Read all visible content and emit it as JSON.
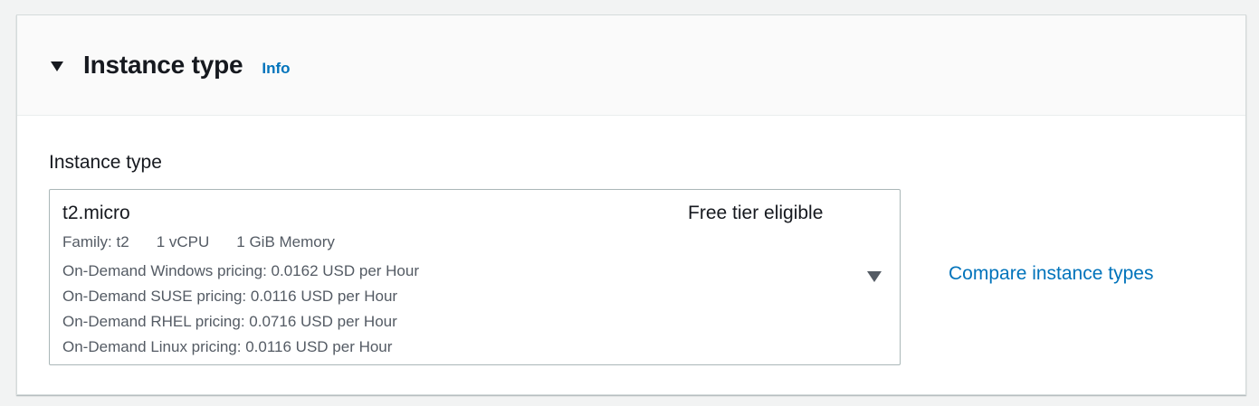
{
  "section": {
    "title": "Instance type",
    "info_label": "Info"
  },
  "field": {
    "label": "Instance type"
  },
  "select": {
    "value": "t2.micro",
    "badge": "Free tier eligible",
    "tags": [
      "Family: t2",
      "1 vCPU",
      "1 GiB Memory"
    ],
    "pricing": [
      "On-Demand Windows pricing: 0.0162 USD per Hour",
      "On-Demand SUSE pricing: 0.0116 USD per Hour",
      "On-Demand RHEL pricing: 0.0716 USD per Hour",
      "On-Demand Linux pricing: 0.0116 USD per Hour"
    ]
  },
  "compare_link": "Compare instance types",
  "colors": {
    "link": "#0073bb",
    "text": "#16191f",
    "secondary_text": "#545b64"
  },
  "icons": {
    "section_toggle": "caret-down-icon",
    "select_toggle": "caret-down-icon"
  }
}
